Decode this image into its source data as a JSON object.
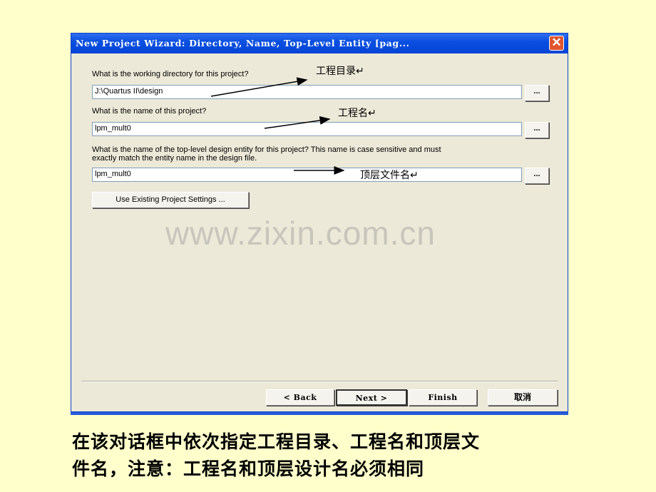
{
  "dialog": {
    "title": "New Project Wizard: Directory, Name, Top-Level Entity [pag...",
    "close_icon": "close-icon",
    "q_directory": "What is the working directory for this project?",
    "directory_value": "J:\\Quartus II\\design",
    "q_name": "What is the name of this project?",
    "name_value": "lpm_mult0",
    "q_entity_line1": "What is the name of the top-level design entity for this project? This name is case sensitive and must",
    "q_entity_line2": "exactly match the entity name in the design file.",
    "entity_value": "lpm_mult0",
    "browse_label": "...",
    "use_existing_label": "Use Existing Project Settings ...",
    "buttons": {
      "back": "< Back",
      "next": "Next >",
      "finish": "Finish",
      "cancel": "取消"
    }
  },
  "annotations": {
    "directory": "工程目录↵",
    "name": "工程名↵",
    "entity": "顶层文件名↵"
  },
  "watermark": "www.zixin.com.cn",
  "caption": {
    "line1": "在该对话框中依次指定工程目录、工程名和顶层文",
    "line2": "件名，注意：工程名和顶层设计名必须相同"
  }
}
